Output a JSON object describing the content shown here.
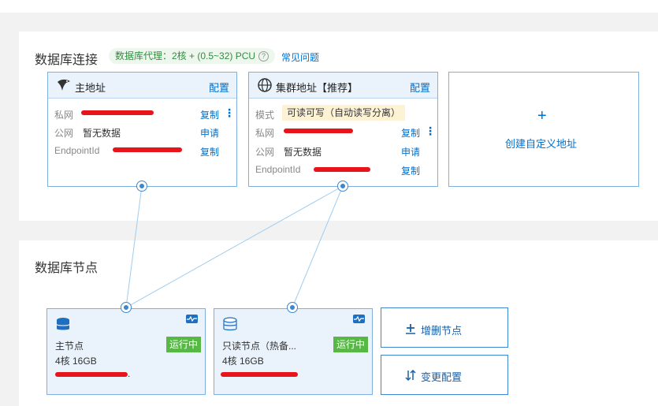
{
  "colors": {
    "link": "#0070cc",
    "card_border": "#7fb0e0",
    "running": "#57b846",
    "redaction": "#e8141c"
  },
  "connection": {
    "title": "数据库连接",
    "proxy_tag": "数据库代理：2核 + (0.5~32) PCU",
    "help_icon": "question-icon",
    "faq": "常见问题"
  },
  "primary_address": {
    "title": "主地址",
    "config": "配置",
    "icon": "bird-icon",
    "rows": [
      {
        "label": "私网",
        "value": "",
        "action": "复制",
        "more": "⋮"
      },
      {
        "label": "公网",
        "value": "暂无数据",
        "action": "申请"
      },
      {
        "label": "EndpointId",
        "value": "",
        "action": "复制"
      }
    ]
  },
  "cluster_address": {
    "title": "集群地址【推荐】",
    "config": "配置",
    "icon": "globe-icon",
    "mode_label": "模式",
    "mode_value": "可读可写（自动读写分离）",
    "rows": [
      {
        "label": "私网",
        "value": "",
        "action": "复制",
        "more": "⋮"
      },
      {
        "label": "公网",
        "value": "暂无数据",
        "action": "申请"
      },
      {
        "label": "EndpointId",
        "value": "",
        "action": "复制"
      }
    ]
  },
  "create_custom": {
    "plus": "+",
    "label": "创建自定义地址"
  },
  "nodes_section": {
    "title": "数据库节点"
  },
  "nodes": [
    {
      "name": "主节点",
      "spec": "4核 16GB",
      "status": "运行中",
      "icon": "database-icon",
      "monitor_icon": "monitor-icon",
      "id_suffix": "."
    },
    {
      "name": "只读节点（热备...",
      "spec": "4核 16GB",
      "status": "运行中",
      "icon": "database-icon",
      "monitor_icon": "monitor-icon",
      "id_suffix": ""
    }
  ],
  "actions": {
    "add_remove_nodes": "增删节点",
    "change_config": "变更配置",
    "add_icon": "add-node-icon",
    "change_icon": "swap-icon"
  }
}
